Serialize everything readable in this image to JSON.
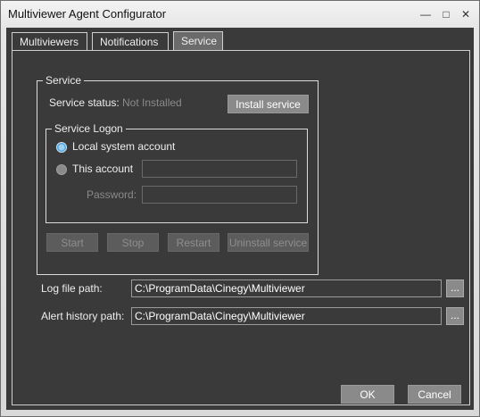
{
  "window": {
    "title": "Multiviewer Agent Configurator",
    "controls": {
      "minimize": "—",
      "maximize": "□",
      "close": "✕"
    }
  },
  "tabs": [
    {
      "label": "Multiviewers"
    },
    {
      "label": "Notifications"
    },
    {
      "label": "Service",
      "active": true
    }
  ],
  "service": {
    "group_title": "Service",
    "status_label": "Service status:",
    "status_value": "Not Installed",
    "install_button": "Install service",
    "logon": {
      "group_title": "Service Logon",
      "local_system_label": "Local system account",
      "local_system_selected": true,
      "this_account_label": "This account",
      "this_account_selected": false,
      "account_value": "",
      "password_label": "Password:",
      "password_value": ""
    },
    "buttons": {
      "start": "Start",
      "stop": "Stop",
      "restart": "Restart",
      "uninstall": "Uninstall service"
    }
  },
  "paths": {
    "log_label": "Log file path:",
    "log_value": "C:\\ProgramData\\Cinegy\\Multiviewer",
    "alert_label": "Alert history path:",
    "alert_value": "C:\\ProgramData\\Cinegy\\Multiviewer",
    "browse_label": "..."
  },
  "footer": {
    "ok": "OK",
    "cancel": "Cancel"
  },
  "colors": {
    "panel_bg": "#3a3a3a",
    "button_bg": "#8a8a8a",
    "radio_selected": "#5aa7dc"
  }
}
